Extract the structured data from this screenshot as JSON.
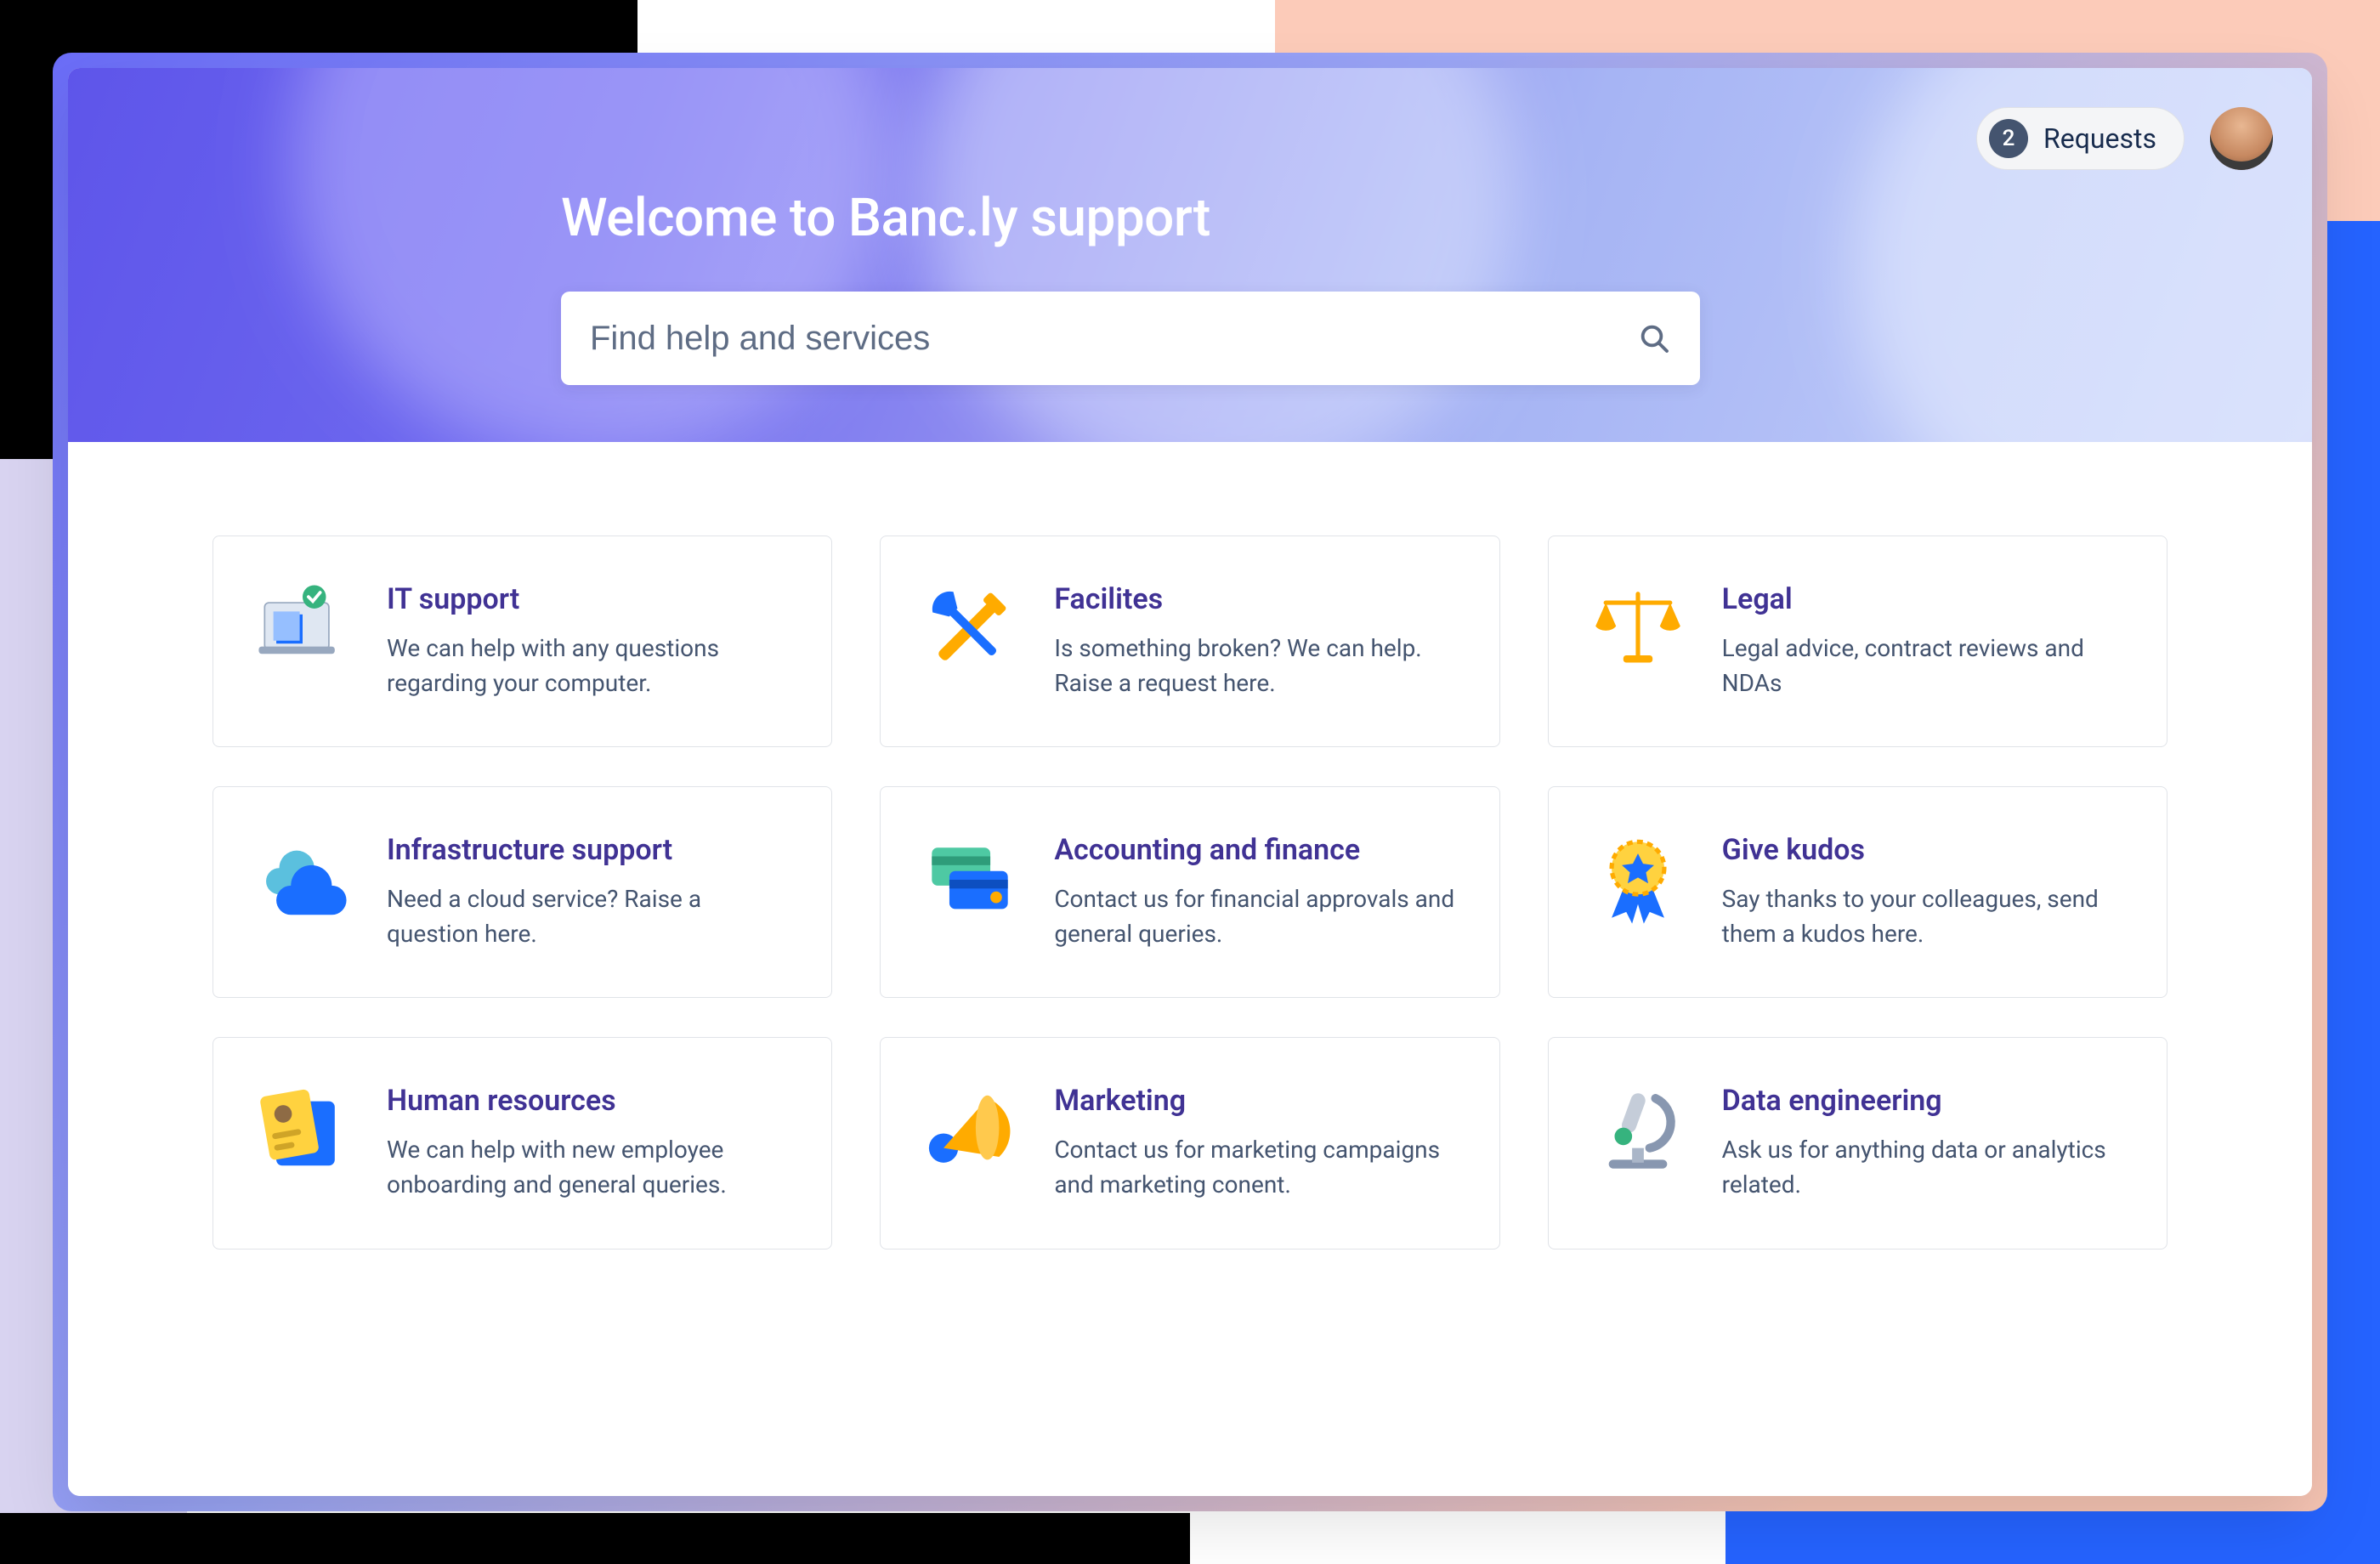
{
  "header": {
    "title": "Welcome to Banc.ly support",
    "search_placeholder": "Find help and services",
    "requests_badge": "2",
    "requests_label": "Requests"
  },
  "cards": [
    {
      "title": "IT support",
      "desc": "We can help with any questions regarding your computer.",
      "icon": "computer-check-icon"
    },
    {
      "title": "Facilites",
      "desc": "Is something broken? We can help. Raise a request here.",
      "icon": "tools-icon"
    },
    {
      "title": "Legal",
      "desc": "Legal advice, contract reviews and NDAs",
      "icon": "scales-icon"
    },
    {
      "title": "Infrastructure support",
      "desc": "Need a cloud service? Raise a question here.",
      "icon": "cloud-icon"
    },
    {
      "title": "Accounting and finance",
      "desc": "Contact us for financial approvals and general queries.",
      "icon": "credit-cards-icon"
    },
    {
      "title": "Give kudos",
      "desc": "Say thanks to your colleagues, send them a kudos here.",
      "icon": "award-ribbon-icon"
    },
    {
      "title": "Human resources",
      "desc": "We can help with new employee onboarding and general queries.",
      "icon": "id-badge-icon"
    },
    {
      "title": "Marketing",
      "desc": "Contact us for marketing campaigns and marketing conent.",
      "icon": "megaphone-icon"
    },
    {
      "title": "Data engineering",
      "desc": "Ask us for anything data or analytics related.",
      "icon": "microscope-icon"
    }
  ]
}
